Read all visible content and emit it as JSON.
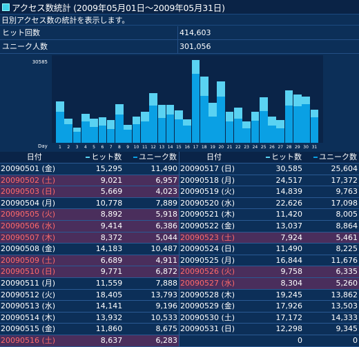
{
  "title": "アクセス数統計 (2009年05月01日〜2009年05月31日)",
  "description": "日別アクセス数の統計を表示します。",
  "stats": [
    {
      "label": "ヒット回数",
      "value": "414,603"
    },
    {
      "label": "ユニーク人数",
      "value": "301,056"
    }
  ],
  "chart_data": {
    "type": "bar",
    "ymax_label": "30585",
    "xlabel": "Day",
    "categories": [
      "1",
      "2",
      "3",
      "4",
      "5",
      "6",
      "7",
      "8",
      "9",
      "10",
      "11",
      "12",
      "13",
      "14",
      "15",
      "16",
      "17",
      "18",
      "19",
      "20",
      "21",
      "22",
      "23",
      "24",
      "25",
      "26",
      "27",
      "28",
      "29",
      "30",
      "31"
    ],
    "ylim": [
      0,
      30585
    ],
    "series": [
      {
        "name": "ヒット数",
        "values": [
          15295,
          9021,
          5669,
          10778,
          8892,
          9414,
          8372,
          14183,
          6689,
          9771,
          11559,
          18405,
          14141,
          13932,
          11860,
          8637,
          30585,
          24517,
          14839,
          22626,
          11420,
          13037,
          7924,
          11490,
          16844,
          9758,
          8304,
          19245,
          17926,
          17172,
          12298
        ]
      },
      {
        "name": "ユニーク数",
        "values": [
          11490,
          6957,
          4023,
          7889,
          5918,
          6386,
          5044,
          10487,
          4911,
          6872,
          7888,
          13793,
          9196,
          10533,
          8675,
          6283,
          25604,
          17372,
          9763,
          17098,
          8005,
          8864,
          5461,
          8225,
          11676,
          6335,
          5260,
          13862,
          13503,
          14333,
          9345
        ]
      }
    ],
    "colors": {
      "hit": "#5ad2f2",
      "unique": "#0aa0e4"
    }
  },
  "table": {
    "headers": {
      "date": "日付",
      "hit": "ヒット数",
      "unique": "ユニーク数"
    },
    "left": [
      {
        "date": "20090501 (金)",
        "hit": "15,295",
        "unique": "11,490",
        "weekend": false
      },
      {
        "date": "20090502 (土)",
        "hit": "9,021",
        "unique": "6,957",
        "weekend": true
      },
      {
        "date": "20090503 (日)",
        "hit": "5,669",
        "unique": "4,023",
        "weekend": true
      },
      {
        "date": "20090504 (月)",
        "hit": "10,778",
        "unique": "7,889",
        "weekend": false
      },
      {
        "date": "20090505 (火)",
        "hit": "8,892",
        "unique": "5,918",
        "weekend": true
      },
      {
        "date": "20090506 (水)",
        "hit": "9,414",
        "unique": "6,386",
        "weekend": true
      },
      {
        "date": "20090507 (木)",
        "hit": "8,372",
        "unique": "5,044",
        "weekend": true
      },
      {
        "date": "20090508 (金)",
        "hit": "14,183",
        "unique": "10,487",
        "weekend": false
      },
      {
        "date": "20090509 (土)",
        "hit": "6,689",
        "unique": "4,911",
        "weekend": true
      },
      {
        "date": "20090510 (日)",
        "hit": "9,771",
        "unique": "6,872",
        "weekend": true
      },
      {
        "date": "20090511 (月)",
        "hit": "11,559",
        "unique": "7,888",
        "weekend": false
      },
      {
        "date": "20090512 (火)",
        "hit": "18,405",
        "unique": "13,793",
        "weekend": false
      },
      {
        "date": "20090513 (水)",
        "hit": "14,141",
        "unique": "9,196",
        "weekend": false
      },
      {
        "date": "20090514 (木)",
        "hit": "13,932",
        "unique": "10,533",
        "weekend": false
      },
      {
        "date": "20090515 (金)",
        "hit": "11,860",
        "unique": "8,675",
        "weekend": false
      },
      {
        "date": "20090516 (土)",
        "hit": "8,637",
        "unique": "6,283",
        "weekend": true
      }
    ],
    "right": [
      {
        "date": "20090517 (日)",
        "hit": "30,585",
        "unique": "25,604",
        "weekend": false
      },
      {
        "date": "20090518 (月)",
        "hit": "24,517",
        "unique": "17,372",
        "weekend": false
      },
      {
        "date": "20090519 (火)",
        "hit": "14,839",
        "unique": "9,763",
        "weekend": false
      },
      {
        "date": "20090520 (水)",
        "hit": "22,626",
        "unique": "17,098",
        "weekend": false
      },
      {
        "date": "20090521 (木)",
        "hit": "11,420",
        "unique": "8,005",
        "weekend": false
      },
      {
        "date": "20090522 (金)",
        "hit": "13,037",
        "unique": "8,864",
        "weekend": false
      },
      {
        "date": "20090523 (土)",
        "hit": "7,924",
        "unique": "5,461",
        "weekend": true
      },
      {
        "date": "20090524 (日)",
        "hit": "11,490",
        "unique": "8,225",
        "weekend": false
      },
      {
        "date": "20090525 (月)",
        "hit": "16,844",
        "unique": "11,676",
        "weekend": false
      },
      {
        "date": "20090526 (火)",
        "hit": "9,758",
        "unique": "6,335",
        "weekend": true
      },
      {
        "date": "20090527 (水)",
        "hit": "8,304",
        "unique": "5,260",
        "weekend": true
      },
      {
        "date": "20090528 (木)",
        "hit": "19,245",
        "unique": "13,862",
        "weekend": false
      },
      {
        "date": "20090529 (金)",
        "hit": "17,926",
        "unique": "13,503",
        "weekend": false
      },
      {
        "date": "20090530 (土)",
        "hit": "17,172",
        "unique": "14,333",
        "weekend": false
      },
      {
        "date": "20090531 (日)",
        "hit": "12,298",
        "unique": "9,345",
        "weekend": false
      },
      {
        "date": "",
        "hit": "0",
        "unique": "0",
        "weekend": false
      }
    ]
  }
}
